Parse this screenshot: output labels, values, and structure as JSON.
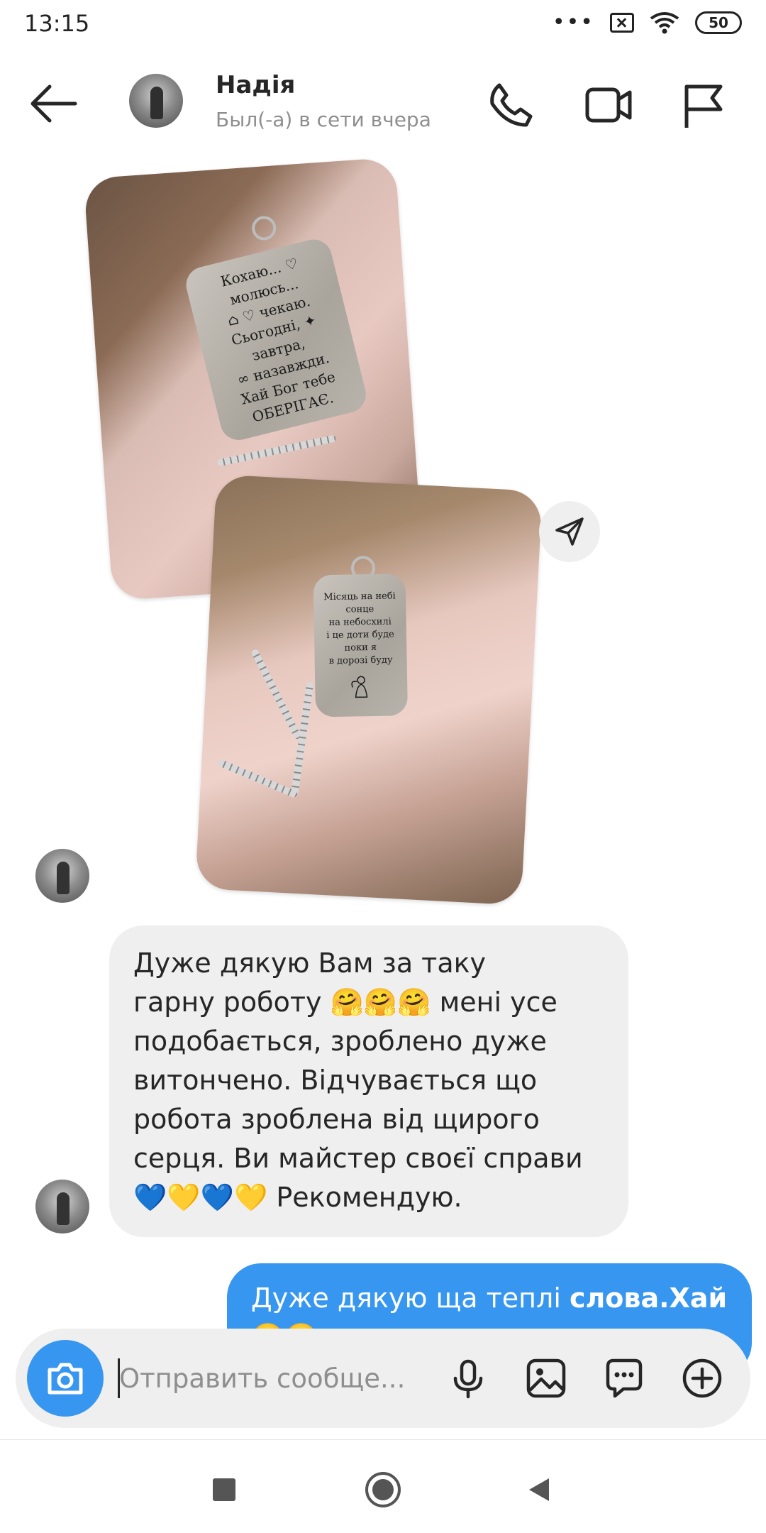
{
  "status_bar": {
    "time": "13:15",
    "dots": "•••",
    "battery": "50",
    "icons": [
      "sim-off-icon",
      "wifi-icon",
      "battery-icon"
    ]
  },
  "header": {
    "contact_name": "Надія",
    "contact_status": "Был(-а) в сети вчера",
    "icons": [
      "back-arrow-icon",
      "phone-icon",
      "video-camera-icon",
      "flag-icon"
    ]
  },
  "photos": [
    {
      "tag_lines": [
        "Кохаю... ♡",
        "молюсь...",
        "⌂ ♡ чекаю.",
        "Сьогодні, ✦",
        "завтра,",
        "∞ назавжди.",
        "Хай Бог тебе",
        "ОБЕРІГАЄ."
      ]
    },
    {
      "tag_lines": [
        "Місяць на небі",
        "сонце",
        "на небосхилі",
        "і це доти буде",
        "поки я",
        "в дорозі буду"
      ]
    }
  ],
  "messages": {
    "incoming": {
      "lines": [
        "Дуже дякую Вам за таку",
        "гарну роботу 🤗🤗🤗 мені усе",
        "подобається, зроблено дуже",
        "витончено. Відчувається що",
        "робота зроблена від щирого",
        "серця. Ви майстер своєї справи",
        "💙💛💙💛 Рекомендую."
      ]
    },
    "outgoing": {
      "text_normal": "Дуже дякую ща теплі ",
      "text_bold": "слова.Хай",
      "line2": "🤗🤗"
    }
  },
  "composer": {
    "placeholder": "Отправить сообще...",
    "icons": [
      "camera-icon",
      "microphone-icon",
      "gallery-icon",
      "sticker-icon",
      "plus-icon"
    ]
  },
  "colors": {
    "accent": "#3797f0",
    "incoming_bubble": "#efefef",
    "muted_text": "#8e8e8e"
  }
}
